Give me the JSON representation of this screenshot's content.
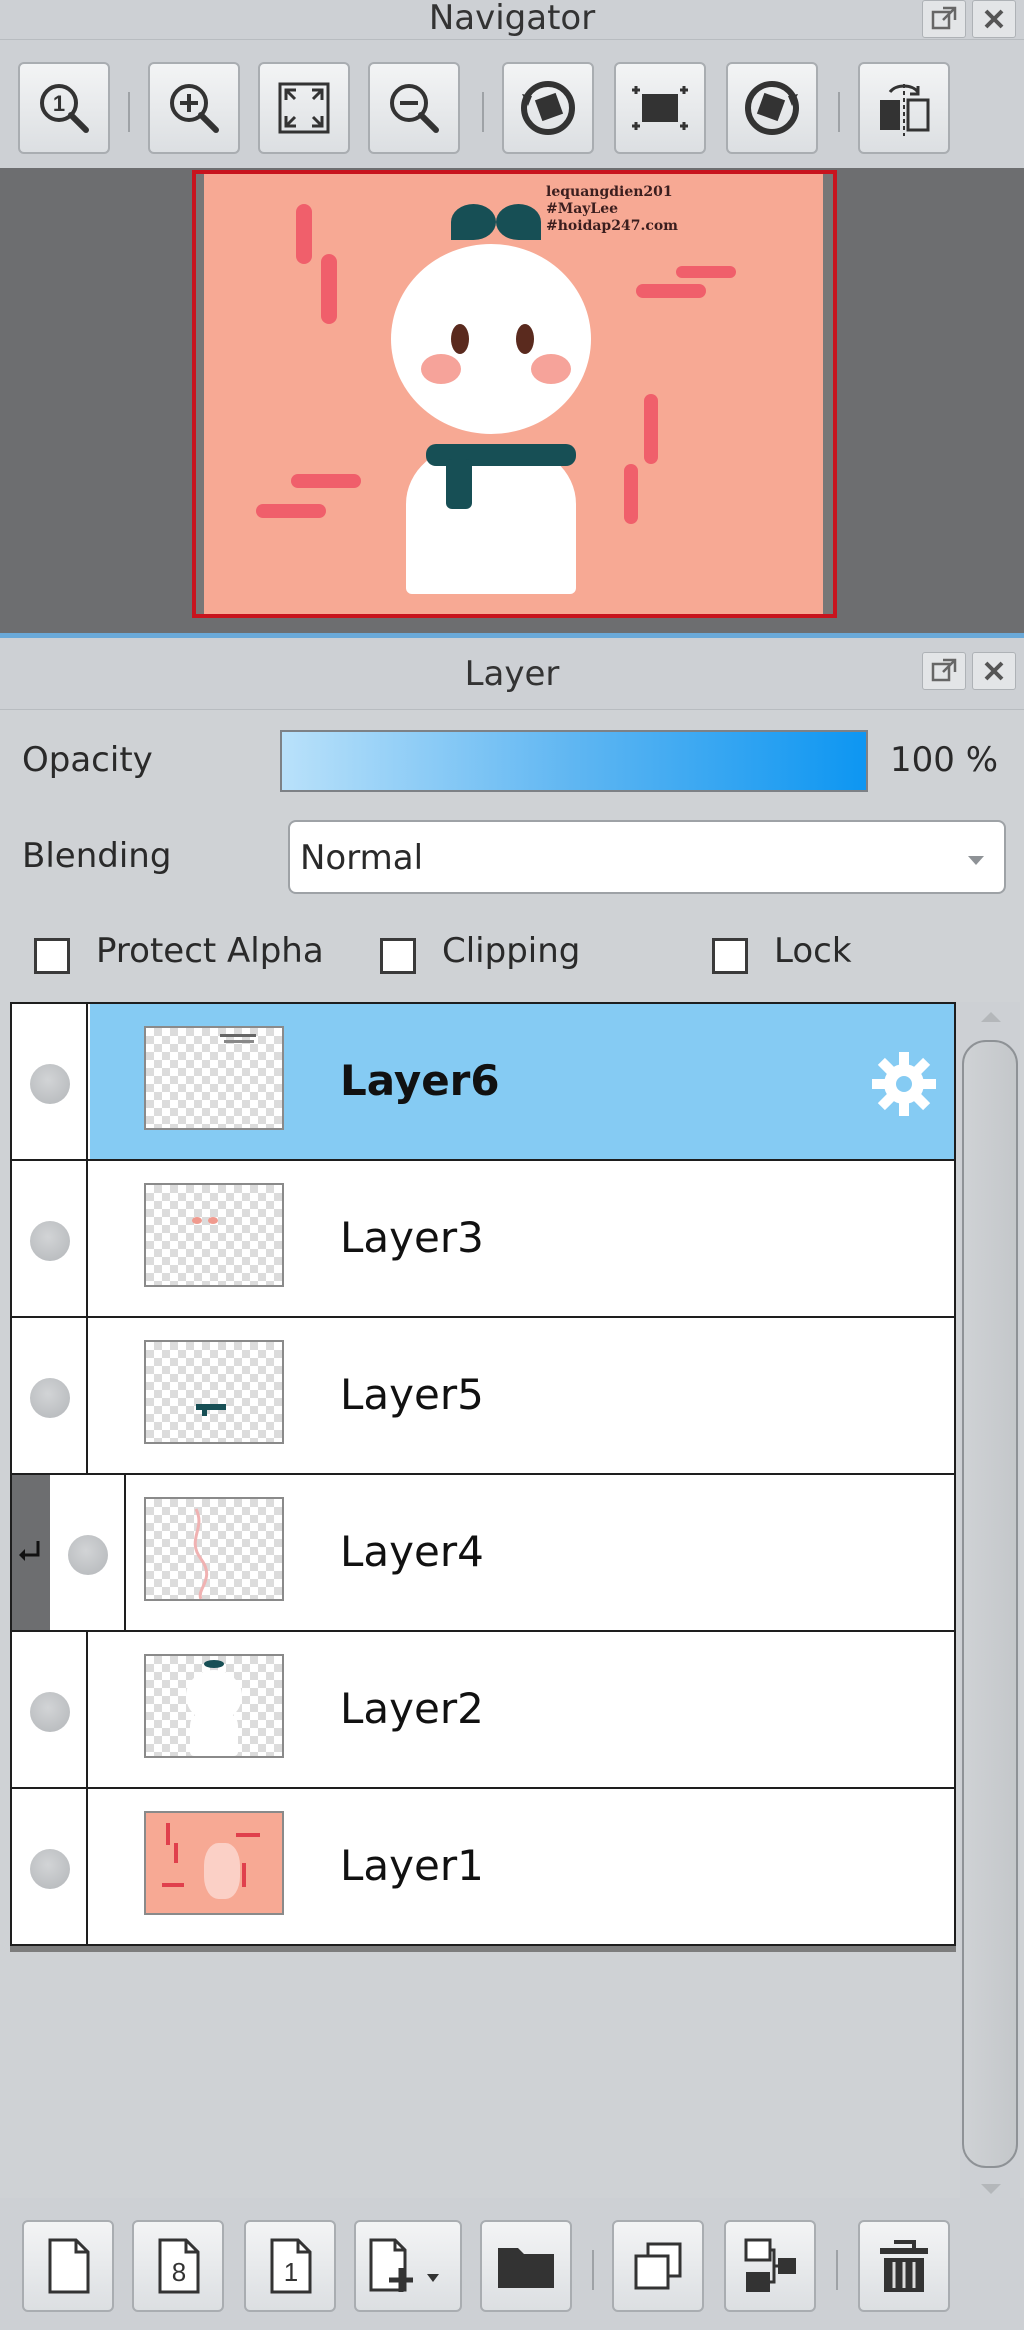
{
  "navigator": {
    "title": "Navigator",
    "canvas_watermark": [
      "lequangdien201",
      "#MayLee",
      "#hoidap247.com"
    ],
    "toolbar": [
      "actual-size-icon",
      "zoom-in-icon",
      "fit-window-icon",
      "zoom-out-icon",
      "rotate-left-icon",
      "reset-rotation-icon",
      "rotate-right-icon",
      "flip-horizontal-icon"
    ]
  },
  "layer_panel": {
    "title": "Layer",
    "opacity_label": "Opacity",
    "opacity_value": "100 %",
    "opacity_level": 1.0,
    "blending_label": "Blending",
    "blending_value": "Normal",
    "protect_alpha_label": "Protect Alpha",
    "clipping_label": "Clipping",
    "lock_label": "Lock",
    "layers": [
      {
        "name": "Layer6",
        "selected": true,
        "clipped": false
      },
      {
        "name": "Layer3",
        "selected": false,
        "clipped": false
      },
      {
        "name": "Layer5",
        "selected": false,
        "clipped": false
      },
      {
        "name": "Layer4",
        "selected": false,
        "clipped": true
      },
      {
        "name": "Layer2",
        "selected": false,
        "clipped": false
      },
      {
        "name": "Layer1",
        "selected": false,
        "clipped": false
      }
    ],
    "bottom_toolbar": [
      "new-layer-icon",
      "new-8bit-layer-icon",
      "new-1bit-layer-icon",
      "add-layer-dropdown-icon",
      "new-folder-icon",
      "duplicate-layer-icon",
      "merge-down-icon",
      "delete-layer-icon"
    ]
  },
  "colors": {
    "selection": "#85cbf3",
    "accent": "#0d96f2",
    "canvas_bg": "#f7a994",
    "highlight_border": "#c8141e"
  }
}
